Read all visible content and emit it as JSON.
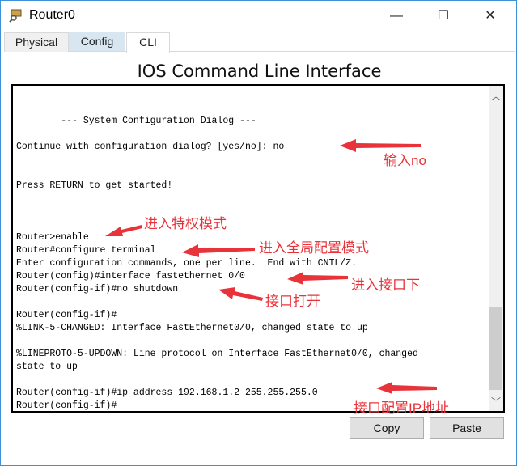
{
  "window": {
    "title": "Router0",
    "minimize": "—",
    "maximize": "☐",
    "close": "✕"
  },
  "tabs": [
    {
      "label": "Physical"
    },
    {
      "label": "Config"
    },
    {
      "label": "CLI"
    }
  ],
  "header": "IOS Command Line Interface",
  "terminal": {
    "text": "\n\n        --- System Configuration Dialog ---\n\nContinue with configuration dialog? [yes/no]: no\n\n\nPress RETURN to get started!\n\n\n\nRouter>enable\nRouter#configure terminal\nEnter configuration commands, one per line.  End with CNTL/Z.\nRouter(config)#interface fastethernet 0/0\nRouter(config-if)#no shutdown\n\nRouter(config-if)#\n%LINK-5-CHANGED: Interface FastEthernet0/0, changed state to up\n\n%LINEPROTO-5-UPDOWN: Line protocol on Interface FastEthernet0/0, changed\nstate to up\n\nRouter(config-if)#ip address 192.168.1.2 255.255.255.0\nRouter(config-if)#"
  },
  "buttons": {
    "copy": "Copy",
    "paste": "Paste"
  },
  "annotations": [
    "输入no",
    "进入特权模式",
    "进入全局配置模式",
    "进入接口下",
    "接口打开",
    "接口配置IP地址"
  ],
  "colors": {
    "annotation": "#e8333a"
  }
}
